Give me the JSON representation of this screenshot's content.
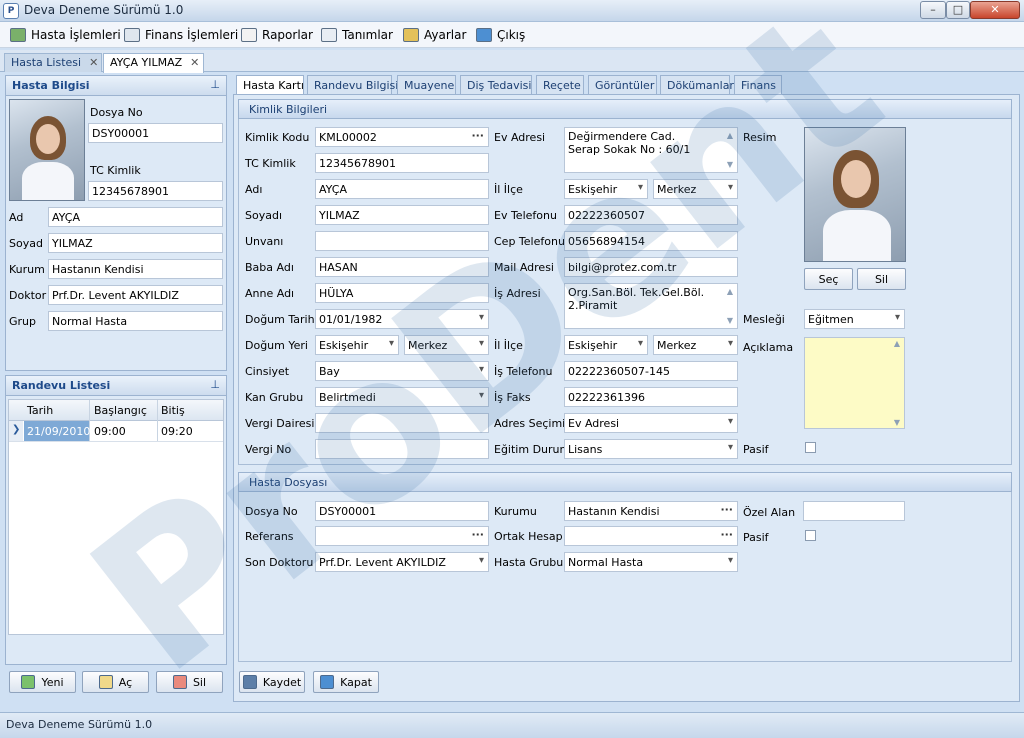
{
  "window": {
    "title": "Deva Deneme Sürümü 1.0",
    "app_icon_letter": "P"
  },
  "menu": [
    {
      "label": "Hasta İşlemleri",
      "icon": "patient-icon"
    },
    {
      "label": "Finans İşlemleri",
      "icon": "calculator-icon"
    },
    {
      "label": "Raporlar",
      "icon": "report-icon"
    },
    {
      "label": "Tanımlar",
      "icon": "list-icon"
    },
    {
      "label": "Ayarlar",
      "icon": "settings-icon"
    },
    {
      "label": "Çıkış",
      "icon": "exit-icon"
    }
  ],
  "doc_tabs": [
    {
      "label": "Hasta Listesi"
    },
    {
      "label": "AYÇA YILMAZ"
    }
  ],
  "left_panel": {
    "title": "Hasta Bilgisi",
    "dosya_no_label": "Dosya No",
    "dosya_no": "DSY00001",
    "tc_label": "TC Kimlik",
    "tc": "12345678901",
    "rows": [
      {
        "label": "Ad",
        "value": "AYÇA"
      },
      {
        "label": "Soyad",
        "value": "YILMAZ"
      },
      {
        "label": "Kurum",
        "value": "Hastanın Kendisi"
      },
      {
        "label": "Doktor",
        "value": "Prf.Dr. Levent AKYILDIZ"
      },
      {
        "label": "Grup",
        "value": "Normal Hasta"
      }
    ]
  },
  "appointments": {
    "title": "Randevu Listesi",
    "columns": [
      "Tarih",
      "Başlangıç",
      "Bitiş"
    ],
    "rows": [
      {
        "date": "21/09/2010",
        "start": "09:00",
        "end": "09:20"
      }
    ],
    "buttons": {
      "new": "Yeni",
      "open": "Aç",
      "delete": "Sil"
    }
  },
  "form_tabs": [
    "Hasta Kartı",
    "Randevu Bilgisi",
    "Muayene",
    "Diş Tedavisi",
    "Reçete",
    "Görüntüler",
    "Dökümanlar",
    "Finans"
  ],
  "kimlik": {
    "header": "Kimlik Bilgileri",
    "kimlik_kodu_label": "Kimlik Kodu",
    "kimlik_kodu": "KML00002",
    "tc_label": "TC Kimlik",
    "tc": "12345678901",
    "adi_label": "Adı",
    "adi": "AYÇA",
    "soyadi_label": "Soyadı",
    "soyadi": "YILMAZ",
    "unvani_label": "Unvanı",
    "unvani": "",
    "baba_label": "Baba Adı",
    "baba": "HASAN",
    "anne_label": "Anne Adı",
    "anne": "HÜLYA",
    "dogum_tarihi_label": "Doğum Tarihi",
    "dogum_tarihi": "01/01/1982",
    "dogum_yeri_label": "Doğum Yeri",
    "dogum_il": "Eskişehir",
    "dogum_ilce": "Merkez",
    "cinsiyet_label": "Cinsiyet",
    "cinsiyet": "Bay",
    "kan_label": "Kan Grubu",
    "kan": "Belirtmedi",
    "vergi_dairesi_label": "Vergi Dairesi",
    "vergi_dairesi": "",
    "vergi_no_label": "Vergi No",
    "vergi_no": "",
    "ev_adresi_label": "Ev Adresi",
    "ev_adresi_1": "Değirmendere Cad.",
    "ev_adresi_2": "Serap Sokak No : 60/1",
    "il_ilce_label": "İl İlçe",
    "il": "Eskişehir",
    "ilce": "Merkez",
    "ev_tel_label": "Ev Telefonu",
    "ev_tel": "02222360507",
    "cep_label": "Cep Telefonu",
    "cep": "05656894154",
    "mail_label": "Mail Adresi",
    "mail": "bilgi@protez.com.tr",
    "is_adresi_label": "İş Adresi",
    "is_adresi_1": "Org.San.Böl. Tek.Gel.Böl.",
    "is_adresi_2": "2.Piramit",
    "is_il_label": "İl İlçe",
    "is_il": "Eskişehir",
    "is_ilce": "Merkez",
    "is_tel_label": "İş Telefonu",
    "is_tel": "02222360507-145",
    "is_faks_label": "İş Faks",
    "is_faks": "02222361396",
    "adres_secimi_label": "Adres Seçimi",
    "adres_secimi": "Ev Adresi",
    "egitim_label": "Eğitim Durumu",
    "egitim": "Lisans",
    "resim_label": "Resim",
    "sec_button": "Seç",
    "sil_button": "Sil",
    "meslek_label": "Mesleği",
    "meslek": "Eğitmen",
    "aciklama_label": "Açıklama",
    "pasif_label": "Pasif"
  },
  "dosya": {
    "header": "Hasta Dosyası",
    "dosya_no_label": "Dosya No",
    "dosya_no": "DSY00001",
    "referans_label": "Referans",
    "referans": "",
    "son_doktor_label": "Son Doktoru",
    "son_doktor": "Prf.Dr. Levent AKYILDIZ",
    "kurumu_label": "Kurumu",
    "kurumu": "Hastanın Kendisi",
    "ortak_label": "Ortak Hesap",
    "ortak": "",
    "grubu_label": "Hasta Grubu",
    "grubu": "Normal Hasta",
    "ozel_label": "Özel Alan",
    "ozel": "",
    "pasif_label": "Pasif"
  },
  "actions": {
    "save": "Kaydet",
    "close": "Kapat"
  },
  "status": {
    "text": "Deva Deneme Sürümü 1.0"
  },
  "watermark": {
    "text": "ProDent"
  }
}
